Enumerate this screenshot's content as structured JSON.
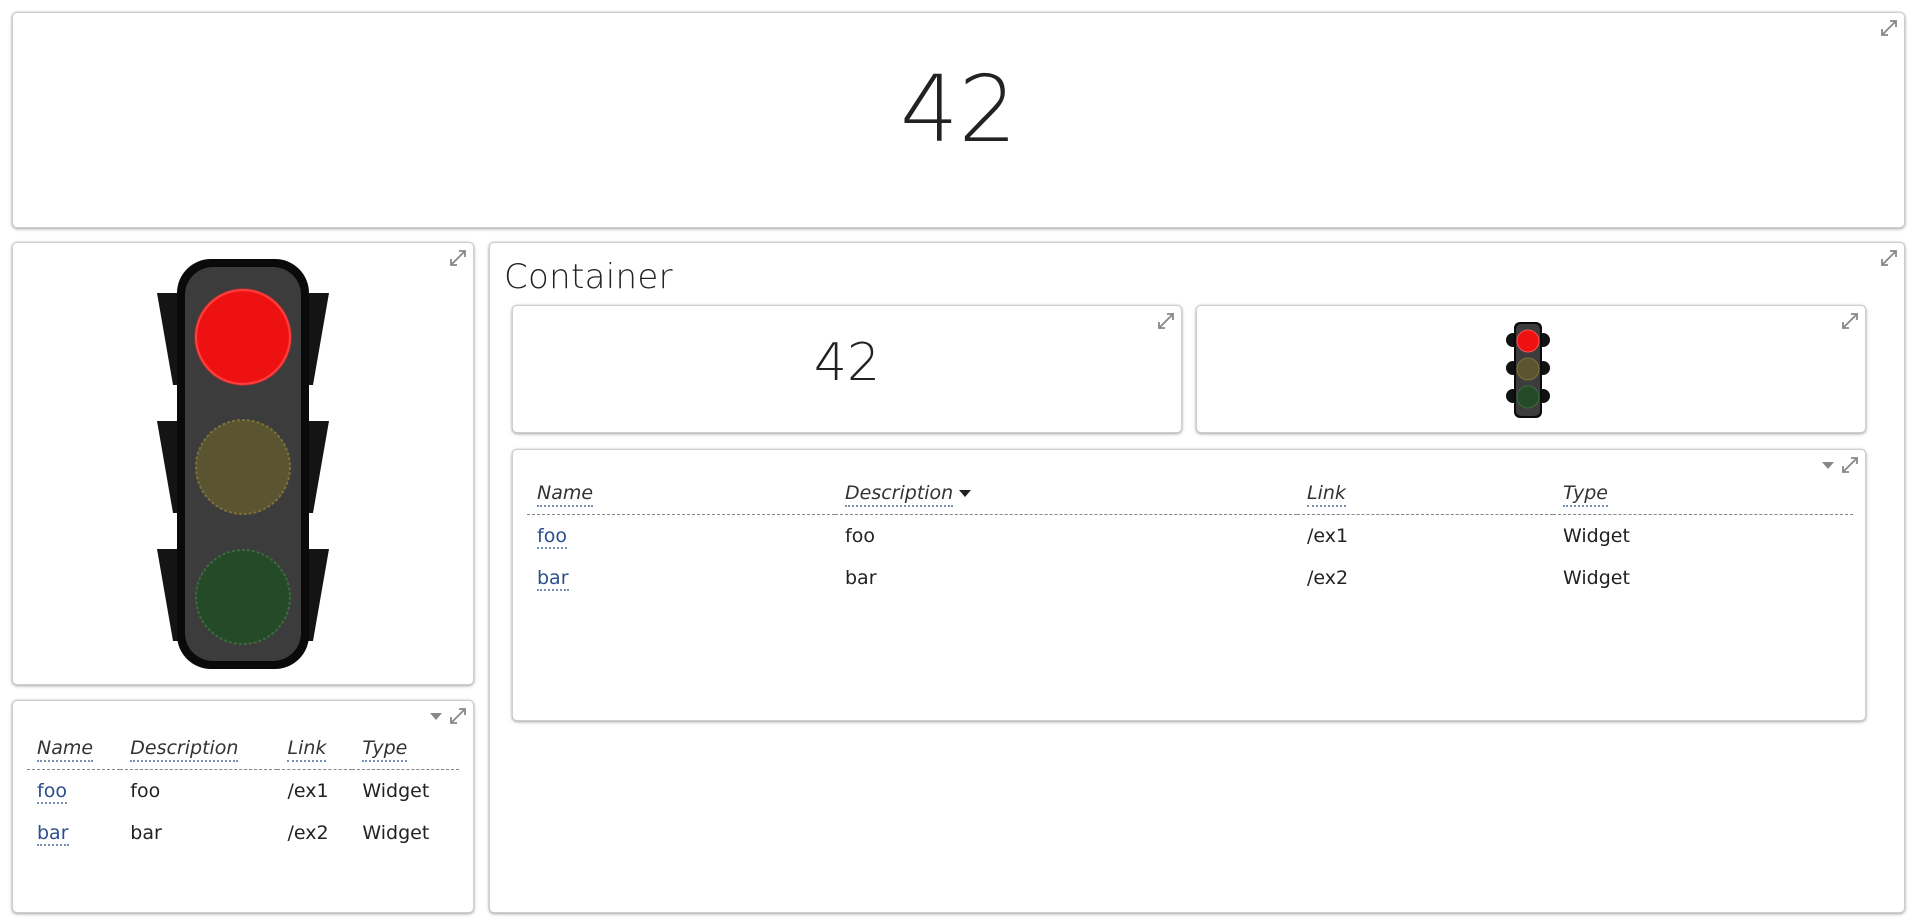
{
  "top_panel": {
    "value": "42"
  },
  "container": {
    "title": "Container"
  },
  "inner_number": {
    "value": "42"
  },
  "traffic_light": {
    "state": "red",
    "colors": {
      "red_on": "#ee1111",
      "yellow_off": "#5a5430",
      "green_off": "#254a28"
    }
  },
  "small_table": {
    "columns": [
      "Name",
      "Description",
      "Link",
      "Type"
    ],
    "rows": [
      {
        "name": "foo",
        "description": "foo",
        "link": "/ex1",
        "type": "Widget"
      },
      {
        "name": "bar",
        "description": "bar",
        "link": "/ex2",
        "type": "Widget"
      }
    ]
  },
  "main_table": {
    "columns": [
      "Name",
      "Description",
      "Link",
      "Type"
    ],
    "sorted_column": "Description",
    "rows": [
      {
        "name": "foo",
        "description": "foo",
        "link": "/ex1",
        "type": "Widget"
      },
      {
        "name": "bar",
        "description": "bar",
        "link": "/ex2",
        "type": "Widget"
      }
    ]
  },
  "icons": {
    "expand": "expand-icon",
    "menu": "menu-caret-icon",
    "sort": "sort-descending-icon"
  }
}
